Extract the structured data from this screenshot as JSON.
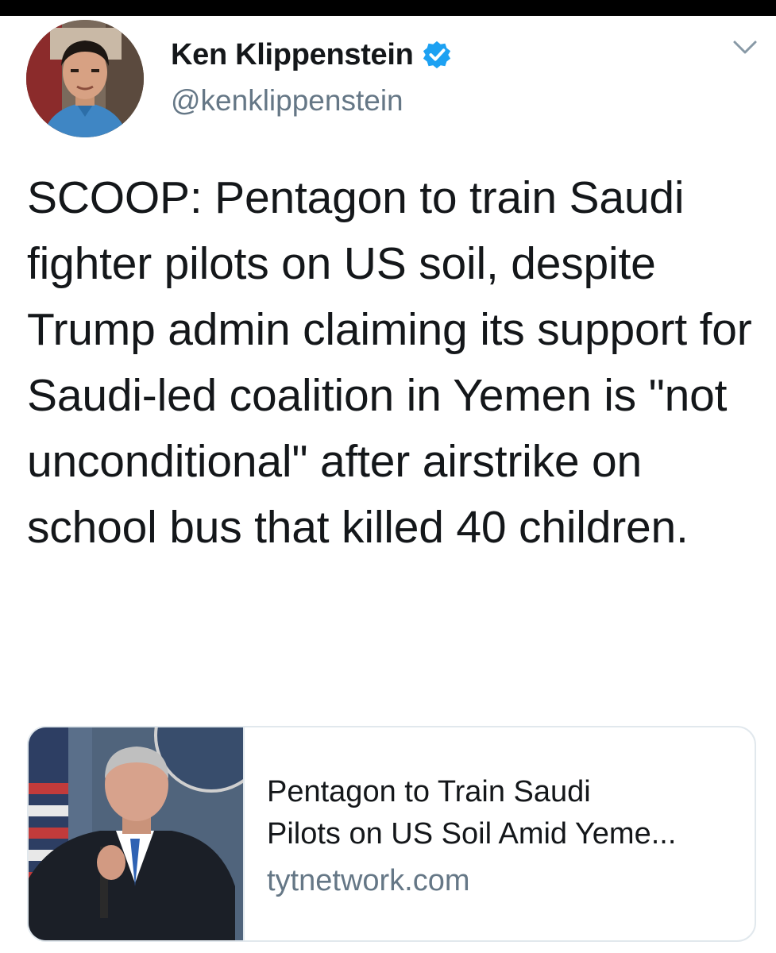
{
  "tweet": {
    "author": {
      "display_name": "Ken Klippenstein",
      "handle": "@kenklippenstein",
      "verified": true,
      "avatar_icon": "profile-photo"
    },
    "menu_icon": "chevron-down-icon",
    "text": "SCOOP: Pentagon to train Saudi fighter pilots on US soil, despite Trump admin claiming its support for Saudi-led coalition in Yemen is \"not unconditional\" after airstrike on school bus that killed 40 children.",
    "link_card": {
      "title_line1": "Pentagon to Train Saudi",
      "title_line2": "Pilots on US Soil Amid Yeme...",
      "domain": "tytnetwork.com",
      "image_icon": "press-briefing-photo"
    }
  },
  "colors": {
    "text_primary": "#14171a",
    "text_secondary": "#657786",
    "verified_blue": "#1da1f2",
    "card_border": "#e1e8ed"
  }
}
